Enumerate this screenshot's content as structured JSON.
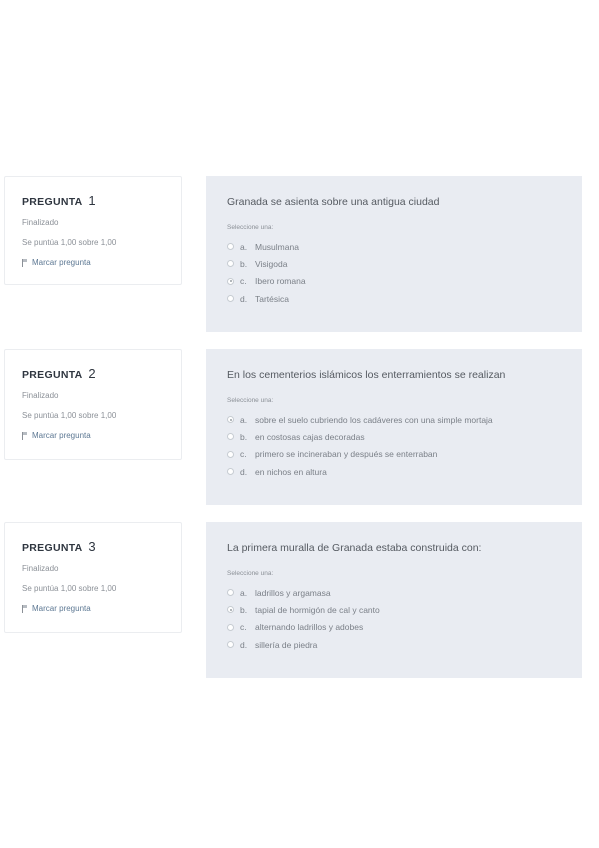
{
  "questions": [
    {
      "label": "PREGUNTA",
      "number": "1",
      "state": "Finalizado",
      "grade": "Se puntúa 1,00 sobre 1,00",
      "flag_label": "Marcar pregunta",
      "text": "Granada se asienta sobre una antigua ciudad",
      "prompt": "Seleccione una:",
      "answers": [
        {
          "letter": "a.",
          "text": "Musulmana",
          "checked": false
        },
        {
          "letter": "b.",
          "text": "Visigoda",
          "checked": false
        },
        {
          "letter": "c.",
          "text": "Ibero romana",
          "checked": true
        },
        {
          "letter": "d.",
          "text": "Tartésica",
          "checked": false
        }
      ]
    },
    {
      "label": "PREGUNTA",
      "number": "2",
      "state": "Finalizado",
      "grade": "Se puntúa 1,00 sobre 1,00",
      "flag_label": "Marcar pregunta",
      "text": "En los cementerios islámicos los enterramientos se realizan",
      "prompt": "Seleccione una:",
      "answers": [
        {
          "letter": "a.",
          "text": "sobre el suelo cubriendo los cadáveres con una simple mortaja",
          "checked": true
        },
        {
          "letter": "b.",
          "text": "en costosas cajas decoradas",
          "checked": false
        },
        {
          "letter": "c.",
          "text": "primero se incineraban y después se enterraban",
          "checked": false
        },
        {
          "letter": "d.",
          "text": "en nichos en altura",
          "checked": false
        }
      ]
    },
    {
      "label": "PREGUNTA",
      "number": "3",
      "state": "Finalizado",
      "grade": "Se puntúa 1,00 sobre 1,00",
      "flag_label": "Marcar pregunta",
      "text": "La primera muralla de Granada estaba construida con:",
      "prompt": "Seleccione una:",
      "answers": [
        {
          "letter": "a.",
          "text": "ladrillos y argamasa",
          "checked": false
        },
        {
          "letter": "b.",
          "text": "tapial de hormigón de cal y canto",
          "checked": true
        },
        {
          "letter": "c.",
          "text": "alternando ladrillos y adobes",
          "checked": false
        },
        {
          "letter": "d.",
          "text": "sillería de piedra",
          "checked": false
        }
      ]
    }
  ]
}
